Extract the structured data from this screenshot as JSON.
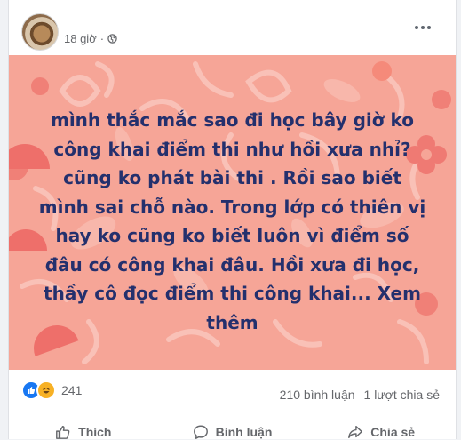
{
  "post": {
    "time": "18 giờ",
    "separator": "·",
    "privacy_icon": "globe-icon",
    "more_icon": "more-options-icon",
    "background_color": "#f6a597",
    "text_color": "#24306d",
    "text": "mình thắc mắc sao đi học bây giờ ko công khai điểm thi như hồi xưa nhỉ? cũng ko phát bài thi . Rồi sao biết mình sai chỗ nào. Trong lớp có thiên vị hay ko cũng ko biết luôn vì điểm số đâu có công khai đâu. Hồi xưa đi học, thầy cô đọc điểm thi công khai...",
    "see_more": "Xem thêm"
  },
  "stats": {
    "reaction_icons": [
      "like-icon",
      "haha-icon"
    ],
    "reaction_count": "241",
    "comments": "210 bình luận",
    "shares": "1 lượt chia sẻ"
  },
  "actions": {
    "like": "Thích",
    "comment": "Bình luận",
    "share": "Chia sẻ"
  }
}
